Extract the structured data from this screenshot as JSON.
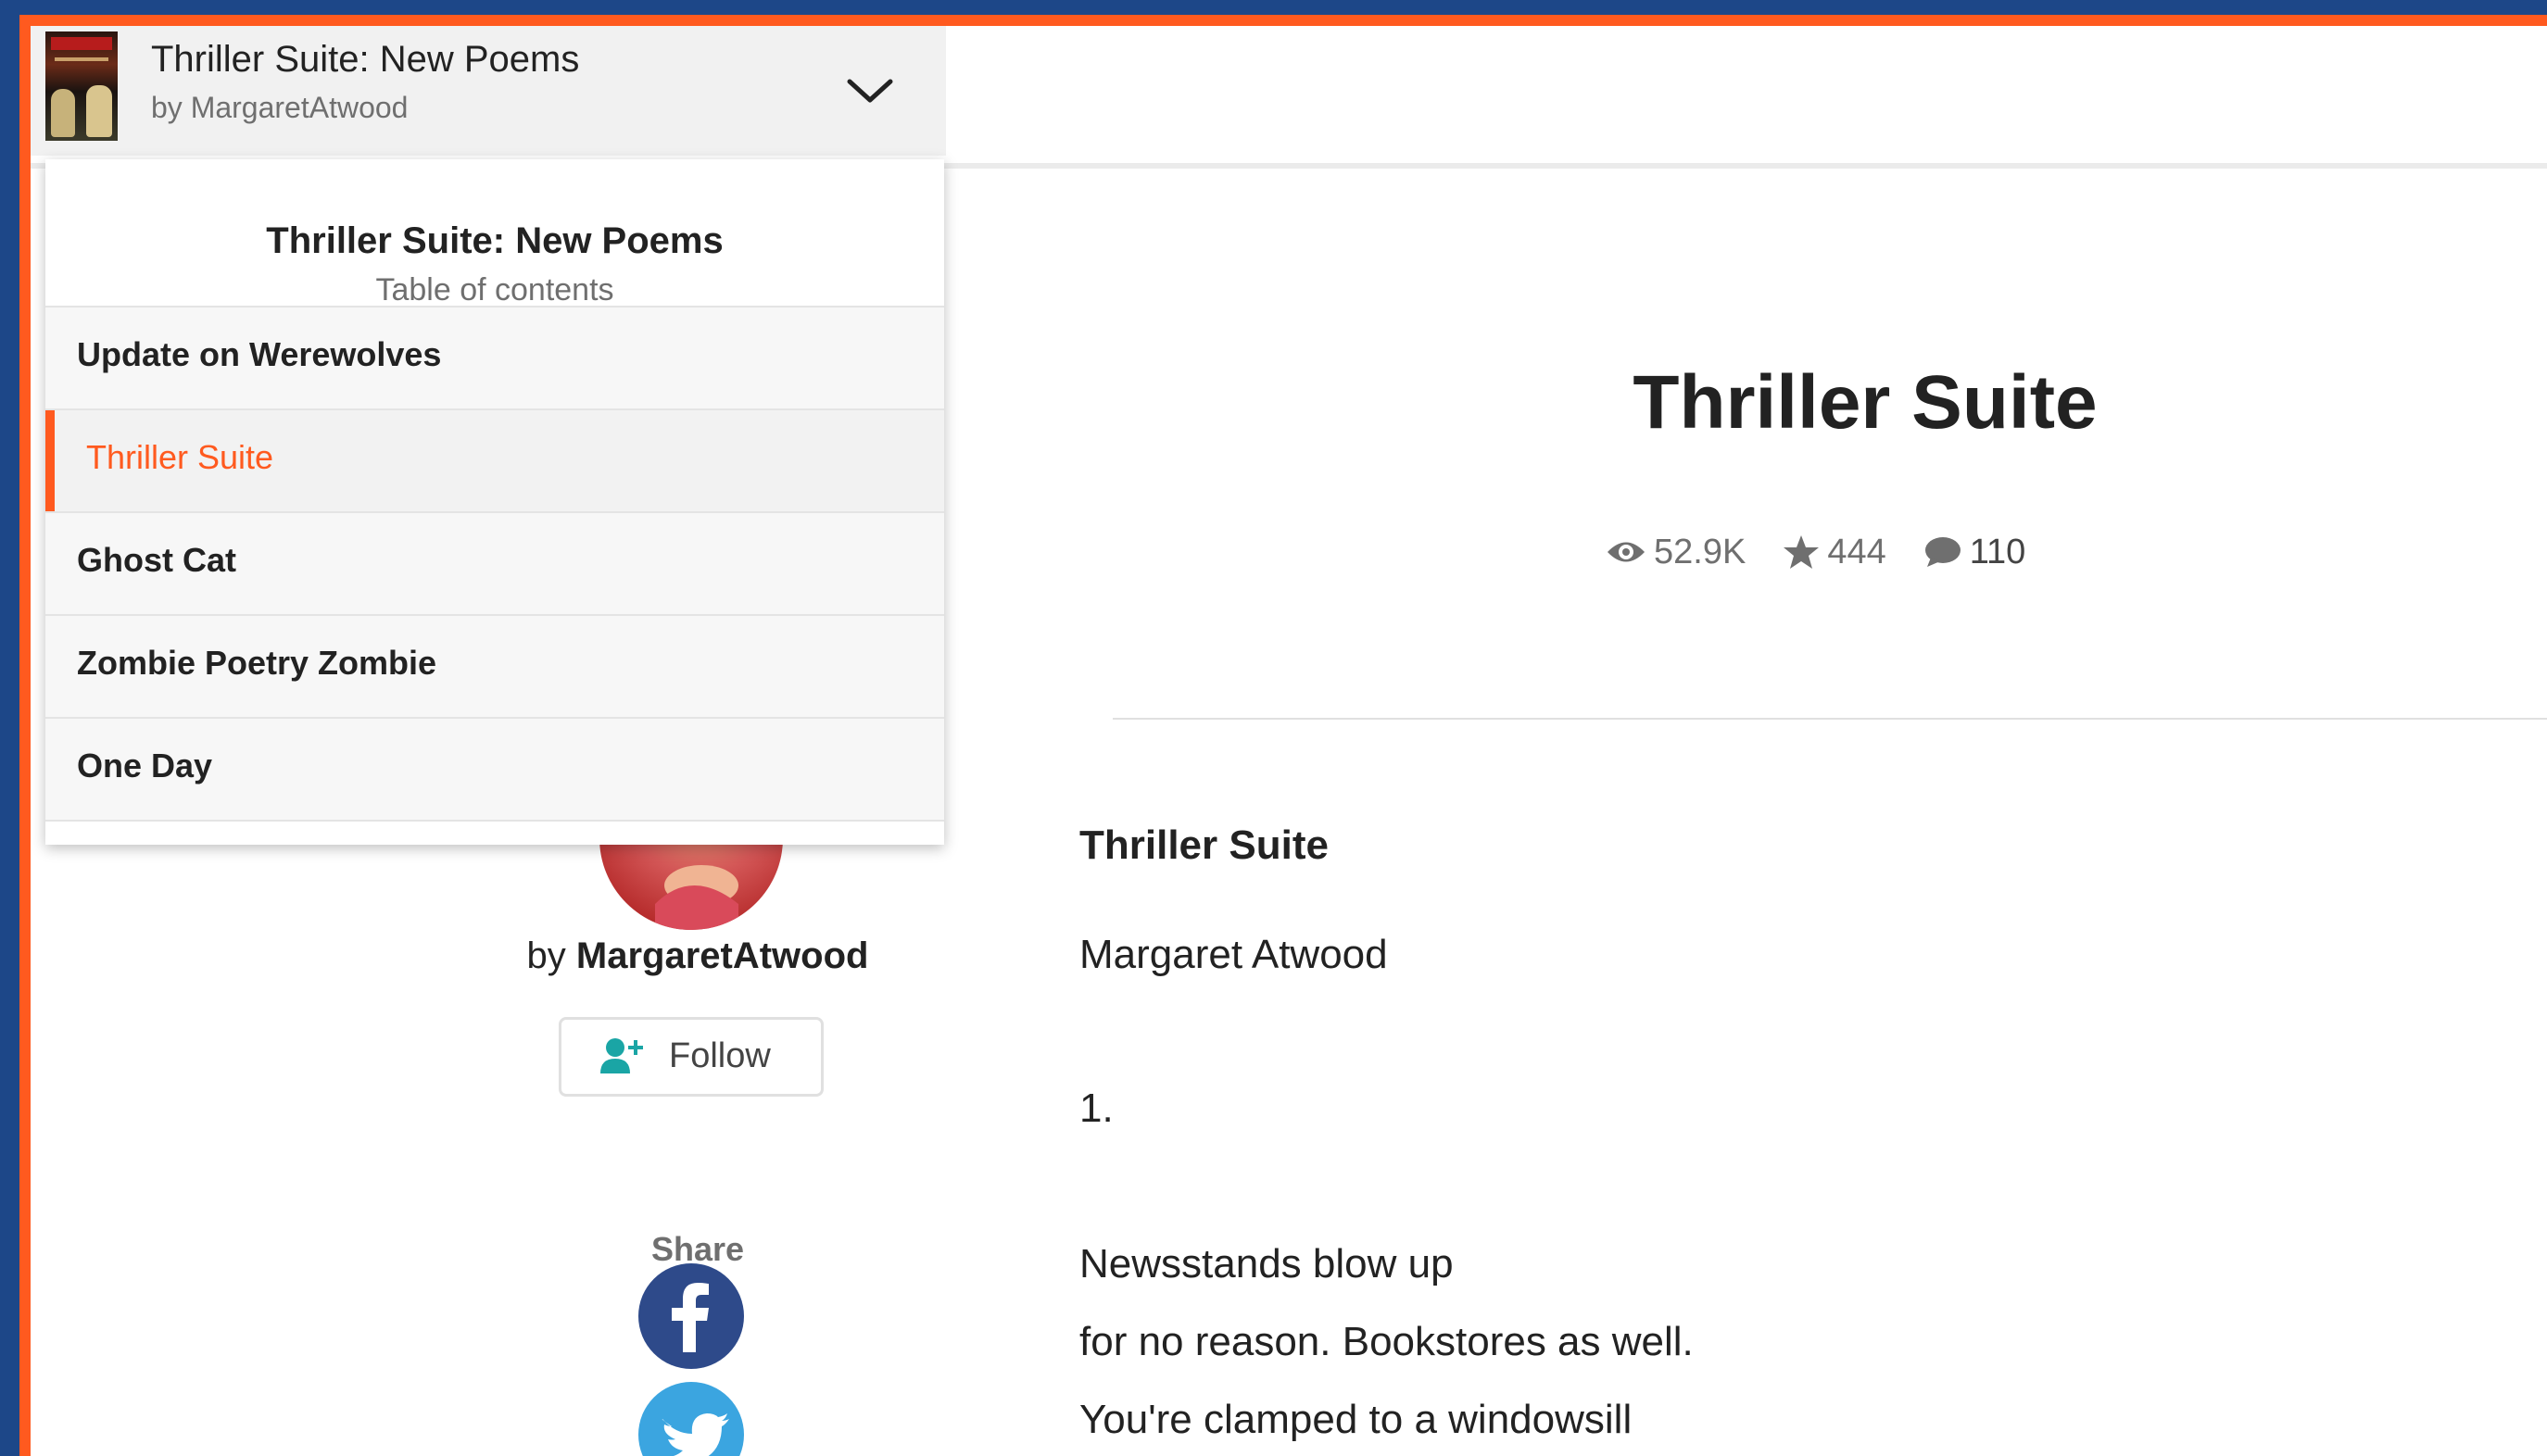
{
  "story": {
    "title": "Thriller Suite: New Poems",
    "author_line": "by MargaretAtwood"
  },
  "toc": {
    "title": "Thriller Suite: New Poems",
    "subtitle": "Table of contents",
    "items": [
      {
        "label": "Update on Werewolves",
        "active": false
      },
      {
        "label": "Thriller Suite",
        "active": true
      },
      {
        "label": "Ghost Cat",
        "active": false
      },
      {
        "label": "Zombie Poetry Zombie",
        "active": false
      },
      {
        "label": "One Day",
        "active": false
      }
    ]
  },
  "author": {
    "by": "by",
    "name": "MargaretAtwood",
    "follow_label": "Follow"
  },
  "share": {
    "label": "Share",
    "networks": [
      "facebook-icon",
      "twitter-icon"
    ]
  },
  "part": {
    "title": "Thriller Suite",
    "stats": {
      "reads": "52.9K",
      "votes": "444",
      "comments": "110"
    }
  },
  "content": {
    "heading": "Thriller Suite",
    "lines": [
      "Margaret Atwood",
      "1.",
      "Newsstands blow up",
      "for no reason. Bookstores as well.",
      "You're clamped to a windowsill"
    ]
  },
  "colors": {
    "accent": "#ff5a1f",
    "frame_blue": "#1d4788",
    "facebook": "#2e4a8a",
    "twitter": "#3ba5e0",
    "follow_icon": "#1aa5a5"
  }
}
